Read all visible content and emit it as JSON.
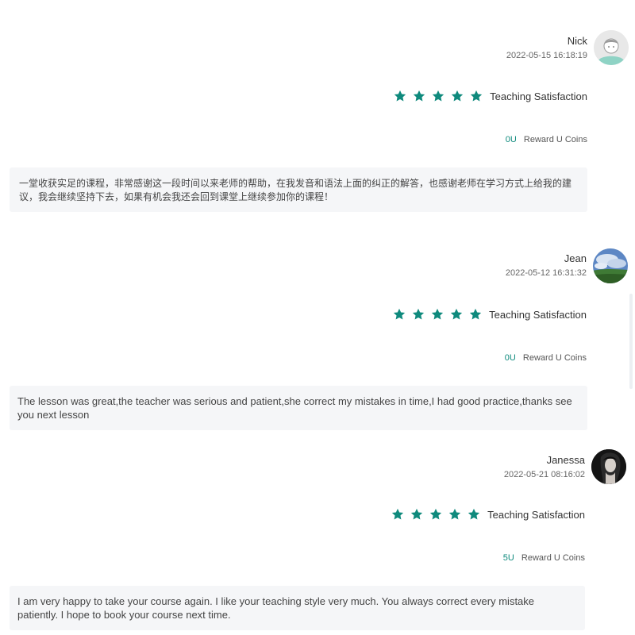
{
  "reviews": [
    {
      "name": "Nick",
      "date": "2022-05-15 16:18:19",
      "avatar_icon": "default-user-avatar-icon",
      "rating": 5,
      "rating_label": "Teaching Satisfaction",
      "coins_amount": "0U",
      "coins_label": "Reward U Coins",
      "comment": "一堂收获实足的课程，非常感谢这一段时间以来老师的帮助，在我发音和语法上面的纠正的解答，也感谢老师在学习方式上给我的建议，我会继续坚持下去，如果有机会我还会回到课堂上继续参加你的课程！"
    },
    {
      "name": "Jean",
      "date": "2022-05-12 16:31:32",
      "avatar_icon": "landscape-photo-avatar-icon",
      "rating": 5,
      "rating_label": "Teaching Satisfaction",
      "coins_amount": "0U",
      "coins_label": "Reward U Coins",
      "comment": "The lesson was great,the teacher was serious and patient,she correct my mistakes in time,I had good practice,thanks see you next lesson"
    },
    {
      "name": "Janessa",
      "date": "2022-05-21 08:16:02",
      "avatar_icon": "portrait-photo-avatar-icon",
      "rating": 5,
      "rating_label": "Teaching Satisfaction",
      "coins_amount": "5U",
      "coins_label": "Reward U Coins",
      "comment": "I am very happy to take your course again. I like your teaching style very much. You always correct every mistake patiently. I hope to book your course next time."
    }
  ],
  "colors": {
    "star": "#0f8a7d",
    "coins_amount": "#0f8a7d",
    "comment_bg": "#f5f6f8"
  }
}
